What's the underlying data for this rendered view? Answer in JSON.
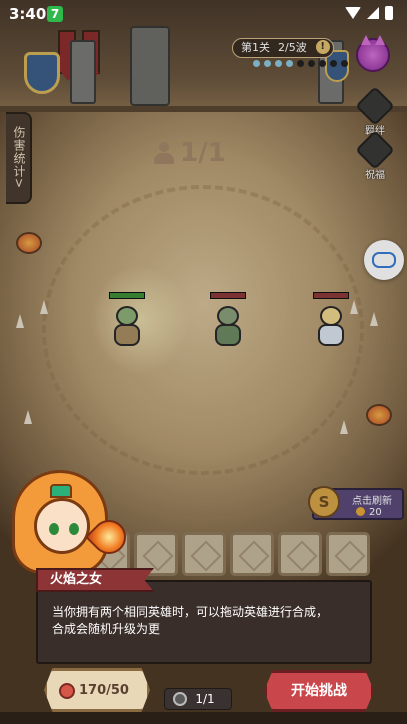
{
  "status_bar": {
    "time": "3:40",
    "notification_badge": "7"
  },
  "top": {
    "level_label": "第1关",
    "wave_label": "2/5波",
    "info_icon": "!",
    "wave_progress": {
      "total": 9,
      "active": 4
    }
  },
  "right_menu": {
    "bond_label": "羁绊",
    "blessing_label": "祝福"
  },
  "left_menu": {
    "damage_stats_label": "伤害统计",
    "damage_stats_arrow": ">"
  },
  "arena": {
    "capacity": "1/1"
  },
  "units": [
    {
      "team": "ally",
      "hp_fraction": 1.0,
      "bar_color": "#3f8f3a"
    },
    {
      "team": "enemy",
      "hp_fraction": 1.0,
      "bar_color": "#8d3a3a"
    },
    {
      "team": "enemy",
      "hp_fraction": 1.0,
      "bar_color": "#8d3a3a"
    }
  ],
  "shop": {
    "refresh_label": "点击刷新",
    "refresh_cost": "20",
    "coin_symbol": "S"
  },
  "tutorial": {
    "speaker": "火焰之女",
    "message_line1": "当你拥有两个相同英雄时，可以拖动英雄进行合成，",
    "message_line2": "合成会随机升级为更"
  },
  "bottom": {
    "resource": "170/50",
    "bench_count": "1/1",
    "start_button": "开始挑战"
  },
  "colors": {
    "start_button": "#c9474a",
    "dialog_name_bg": "#8d3436",
    "wave_dot_active": "#8cc8e0"
  }
}
